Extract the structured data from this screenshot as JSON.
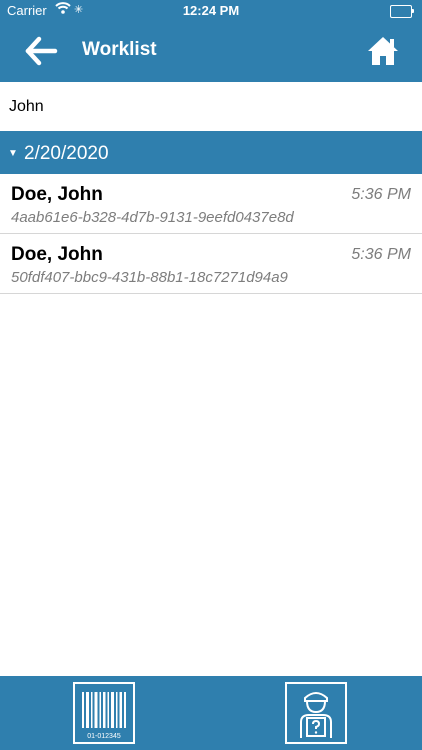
{
  "status_bar": {
    "carrier": "Carrier",
    "time": "12:24 PM"
  },
  "nav": {
    "title": "Worklist",
    "back_icon": "arrow-left-icon",
    "home_icon": "home-icon"
  },
  "search": {
    "value": "John"
  },
  "section": {
    "date": "2/20/2020"
  },
  "rows": [
    {
      "name": "Doe, John",
      "time": "5:36 PM",
      "uid": "4aab61e6-b328-4d7b-9131-9eefd0437e8d"
    },
    {
      "name": "Doe, John",
      "time": "5:36 PM",
      "uid": "50fdf407-bbc9-431b-88b1-18c7271d94a9"
    }
  ],
  "bottom_bar": {
    "scan_icon": "barcode-icon",
    "barcode_text": "01-012345",
    "help_icon": "patient-help-icon"
  },
  "colors": {
    "primary": "#2f7fae",
    "secondary_text": "#7d7d7d"
  }
}
